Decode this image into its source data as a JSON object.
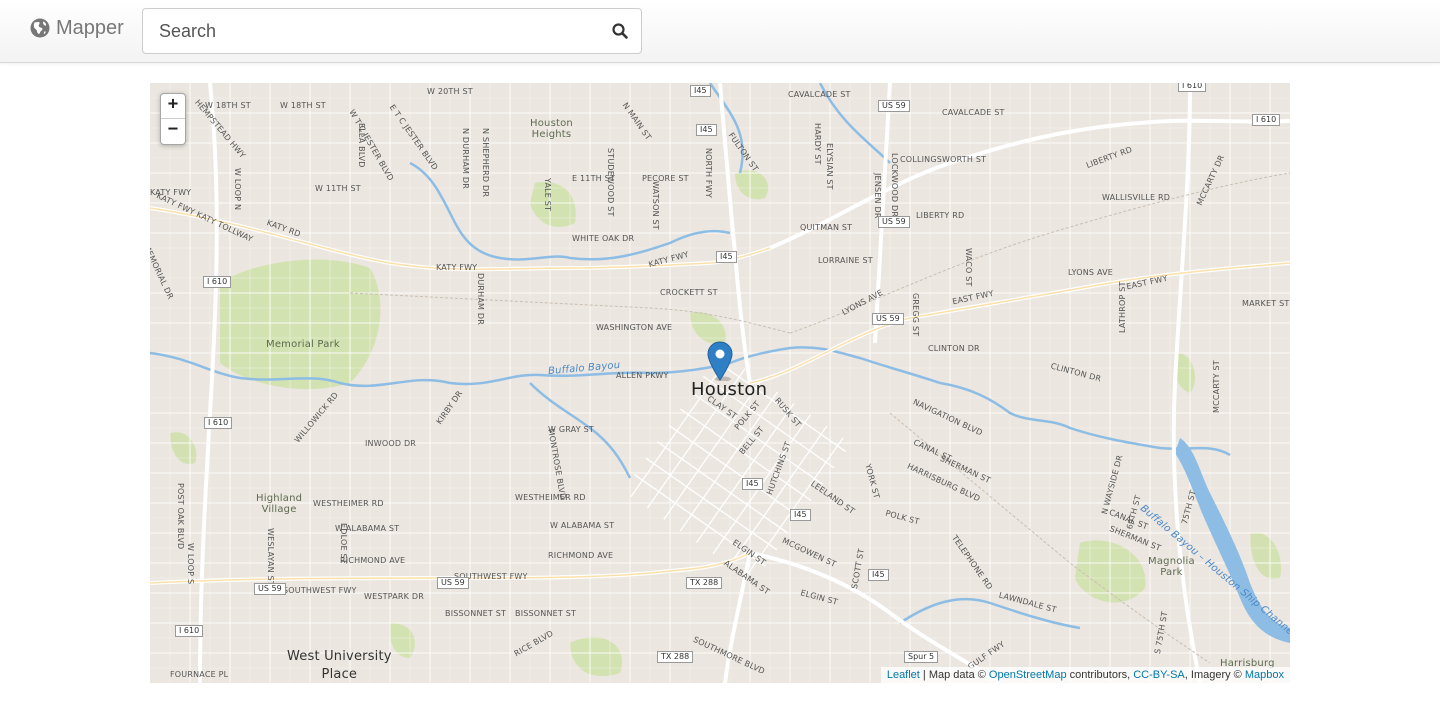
{
  "navbar": {
    "brand": "Mapper",
    "brand_icon": "globe-icon",
    "search_placeholder": "Search",
    "search_icon": "search-icon"
  },
  "map": {
    "zoom_in": "+",
    "zoom_out": "−",
    "marker_icon": "map-marker-icon",
    "city_label": "Houston",
    "attribution": {
      "leaflet": "Leaflet",
      "sep1": " | Map data © ",
      "osm": "OpenStreetMap",
      "sep2": " contributors, ",
      "license": "CC-BY-SA",
      "sep3": ", Imagery © ",
      "imagery": "Mapbox"
    },
    "places": {
      "houston_heights": "Houston\nHeights",
      "memorial_park": "Memorial Park",
      "highland_village": "Highland\nVillage",
      "west_university": "West University\nPlace",
      "magnolia_park": "Magnolia\nPark",
      "harrisburg": "Harrisburg",
      "buffalo_bayou": "Buffalo Bayou",
      "houston_ship_channel": "Buffalo Bayou – Houston Ship Channel"
    },
    "streets": {
      "w20": "W 20TH ST",
      "w18a": "W 18TH ST",
      "w18b": "W 18TH ST",
      "w11": "W 11TH ST",
      "e11": "E 11TH ST",
      "pecore": "PECORE ST",
      "cavalcade1": "CAVALCADE ST",
      "cavalcade2": "CAVALCADE ST",
      "collingsworth": "COLLINGSWORTH ST",
      "liberty_rd": "LIBERTY RD",
      "liberty_rd2": "LIBERTY RD",
      "wallisville": "WALLISVILLE RD",
      "quitman": "QUITMAN ST",
      "lorraine": "LORRAINE ST",
      "white_oak": "WHITE OAK DR",
      "katy_fwy1": "KATY FWY",
      "katy_fwy2": "KATY FWY",
      "katy_fwy3": "KATY FWY",
      "katy_rd": "KATY RD",
      "katy_tollway": "KATY FWY KATY TOLLWAY",
      "crockett": "CROCKETT ST",
      "washington": "WASHINGTON AVE",
      "allen_pkwy": "ALLEN PKWY",
      "lyons1": "LYONS AVE",
      "lyons2": "LYONS AVE",
      "east_fwy1": "EAST FWY",
      "east_fwy2": "EAST FWY",
      "market": "MARKET ST",
      "clinton1": "CLINTON DR",
      "clinton2": "CLINTON DR",
      "navigation": "NAVIGATION BLVD",
      "canal1": "CANAL ST",
      "canal2": "CANAL ST",
      "sherman1": "SHERMAN ST",
      "sherman2": "SHERMAN ST",
      "harrisburg_blvd": "HARRISBURG BLVD",
      "polk1": "POLK ST",
      "polk2": "POLK ST",
      "telephone": "TELEPHONE RD",
      "lawndale": "LAWNDALE ST",
      "gulf_fwy": "GULF FWY",
      "w_gray": "W GRAY ST",
      "inwood": "INWOOD DR",
      "westheimer1": "WESTHEIMER RD",
      "westheimer2": "WESTHEIMER RD",
      "w_alabama1": "W ALABAMA ST",
      "w_alabama2": "W ALABAMA ST",
      "richmond1": "RICHMOND AVE",
      "richmond2": "RICHMOND AVE",
      "southwest_fwy1": "SOUTHWEST FWY",
      "southwest_fwy2": "SOUTHWEST FWY",
      "westpark": "WESTPARK DR",
      "bissonnet1": "BISSONNET ST",
      "bissonnet2": "BISSONNET ST",
      "rice_blvd": "RICE BLVD",
      "southmore": "SOUTHMORE BLVD",
      "fournace": "FOURNACE PL",
      "leeland": "LEELAND ST",
      "mcgowen": "MCGOWEN ST",
      "elgin1": "ELGIN ST",
      "elgin2": "ELGIN ST",
      "alabama": "ALABAMA ST",
      "bell": "BELL ST",
      "rusk": "RUSK ST",
      "clay": "CLAY ST",
      "memorial_dr": "MEMORIAL DR",
      "kirby": "KIRBY DR",
      "montrose": "MONTROSE BLVD",
      "durham1": "DURHAM DR",
      "durham2": "N DURHAM DR",
      "shepherd": "N SHEPHERD DR",
      "yale": "YALE ST",
      "studewood": "STUDEWOOD ST",
      "watson": "WATSON ST",
      "north_fwy": "NORTH FWY",
      "n_main": "N MAIN ST",
      "fulton": "FULTON ST",
      "hardy": "HARDY ST",
      "elysian": "ELYSIAN ST",
      "jensen": "JENSEN DR",
      "lockwood": "LOCKWOOD DR",
      "gregg": "GREGG ST",
      "waco": "WACO ST",
      "lathrop": "LATHROP ST",
      "mccarty": "MCCARTY ST",
      "wayside": "N WAYSIDE DR",
      "york": "YORK ST",
      "scott": "SCOTT ST",
      "hutchins": "HUTCHINS ST",
      "post_oak": "POST OAK BLVD",
      "weslayan": "WESLAYAN ST",
      "edloe": "EDLOE ST",
      "willowick": "WILLOWICK RD",
      "ella": "ELLA BLVD",
      "tc_jester": "W T C JESTER BLVD",
      "e_tc_jester": "E T C JESTER BLVD",
      "hempstead": "HEMPSTEAD HWY",
      "memorial_dr2": "MEMORIAL DR",
      "w_loop": "W LOOP S",
      "w_loop_n": "W LOOP N",
      "dowling": "DOWLING ST",
      "75th": "75TH ST",
      "69th": "69TH ST",
      "s_75th": "S 75TH ST",
      "s_wayside": "S WAYSIDE DR",
      "mccarty_dr": "MCCARTY DR"
    },
    "shields": {
      "i45a": "I45",
      "i45b": "I45",
      "i45c": "I45",
      "i45d": "I45",
      "i45e": "I45",
      "us59a": "US 59",
      "us59b": "US 59",
      "us59c": "US 59",
      "us59d": "US 59",
      "us59e": "US 59",
      "i610a": "I 610",
      "i610b": "I 610",
      "i610c": "I 610",
      "i610d": "I 610",
      "i610e": "I 610",
      "tx288a": "TX 288",
      "tx288b": "TX 288",
      "spur5": "Spur 5",
      "i610f": "I 610"
    }
  }
}
